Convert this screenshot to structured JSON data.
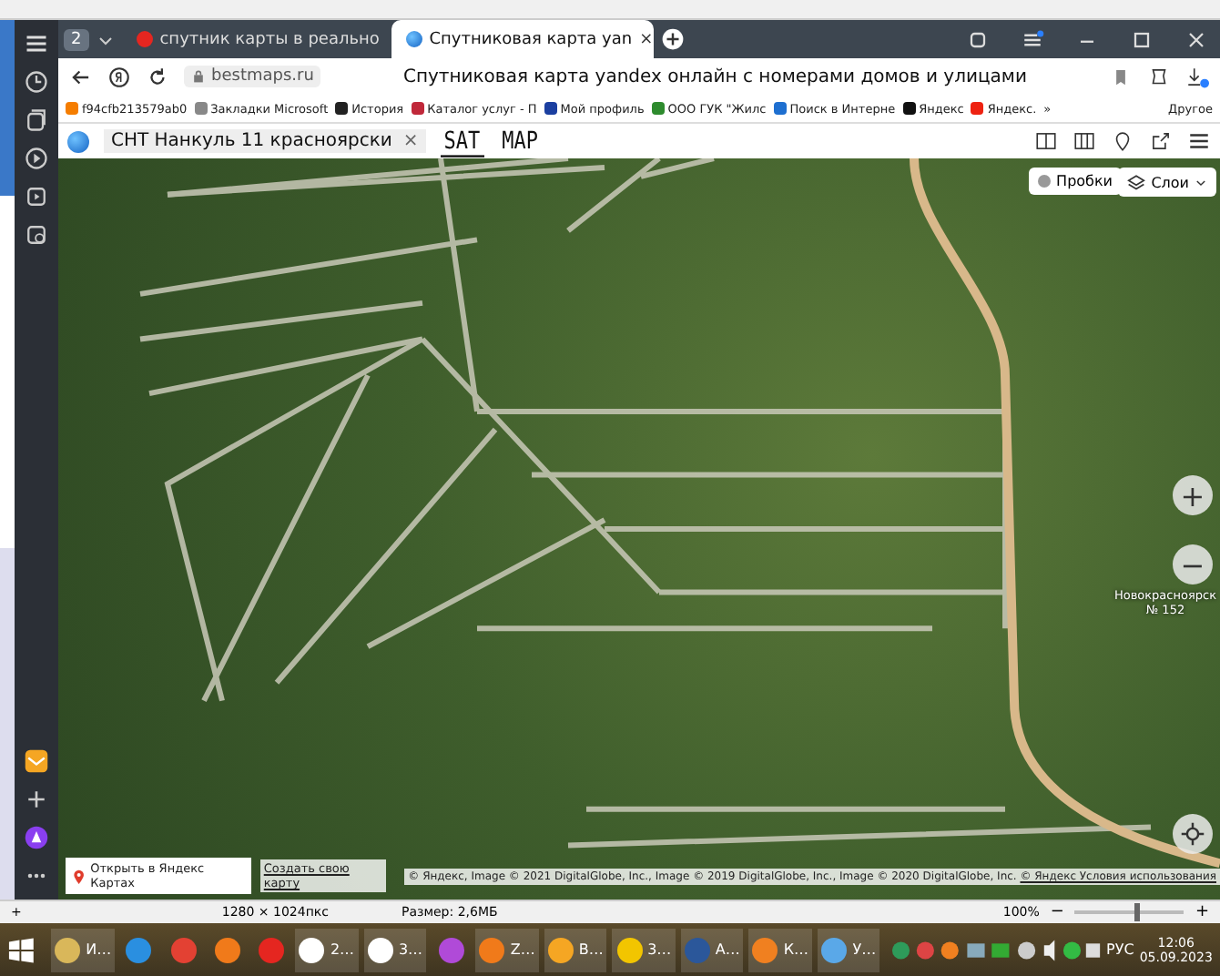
{
  "browser": {
    "tab_count": "2",
    "tabs": [
      {
        "title": "спутник карты в реально",
        "selected": false
      },
      {
        "title": "Спутниковая карта yan",
        "selected": true,
        "close": "×"
      }
    ],
    "address": {
      "domain": "bestmaps.ru",
      "page_title": "Спутниковая карта yandex онлайн с номерами домов и улицами"
    },
    "bookmarks": [
      {
        "label": "f94cfb213579ab0",
        "kind": "blog"
      },
      {
        "label": "Закладки Microsoft",
        "kind": "folder"
      },
      {
        "label": "История",
        "kind": "history"
      },
      {
        "label": "Каталог услуг - П",
        "kind": "flag"
      },
      {
        "label": "Мой профиль",
        "kind": "ms"
      },
      {
        "label": "ООО ГУК \"Жилс",
        "kind": "tree"
      },
      {
        "label": "Поиск в Интерне",
        "kind": "search"
      },
      {
        "label": "Яндекс",
        "kind": "dark"
      },
      {
        "label": "Яндекс.",
        "kind": "ya"
      }
    ],
    "bookmarks_more": "»",
    "bookmarks_other": "Другое"
  },
  "site": {
    "search": {
      "value": "СНТ Нанкуль 11 красноярски"
    },
    "clear": "×",
    "modes": [
      {
        "label": "SAT",
        "selected": true
      },
      {
        "label": "MAP",
        "selected": false
      }
    ]
  },
  "map": {
    "traffic": "Пробки",
    "layers": "Слои",
    "zoom_in": "+",
    "zoom_out": "−",
    "place_labels": [
      "Новокрасноярск",
      "№ 152"
    ],
    "open_link": "Открыть в Яндекс Картах",
    "create_link": "Создать свою карту",
    "copyright": "© Яндекс, Image © 2021 DigitalGlobe, Inc., Image © 2019 DigitalGlobe, Inc., Image © 2020 DigitalGlobe, Inc.",
    "terms": "© Яндекс Условия использования"
  },
  "status_bar": {
    "cursor": "+",
    "zoom_minus": "−",
    "zoom_plus": "+",
    "dimensions": "1280 × 1024пкс",
    "size": "Размер: 2,6МБ",
    "zoom": "100%",
    "zoom_level": {
      "level": 0.55
    }
  },
  "taskbar": {
    "items": [
      {
        "kind": "folder",
        "label": "И…"
      },
      {
        "kind": "ie"
      },
      {
        "kind": "chrome"
      },
      {
        "kind": "firefox"
      },
      {
        "kind": "yandex"
      },
      {
        "kind": "ybrowser",
        "label": "2…"
      },
      {
        "kind": "ybrowser",
        "label": "3…"
      },
      {
        "kind": "gem"
      },
      {
        "kind": "firefox",
        "label": "Z…"
      },
      {
        "kind": "mail",
        "label": "В…"
      },
      {
        "kind": "onec",
        "label": "3…"
      },
      {
        "kind": "word",
        "label": "А…"
      },
      {
        "kind": "chart",
        "label": "К…"
      },
      {
        "kind": "globe",
        "label": "У…"
      }
    ],
    "language": "РУС",
    "time": "12:06",
    "date": "05.09.2023"
  }
}
